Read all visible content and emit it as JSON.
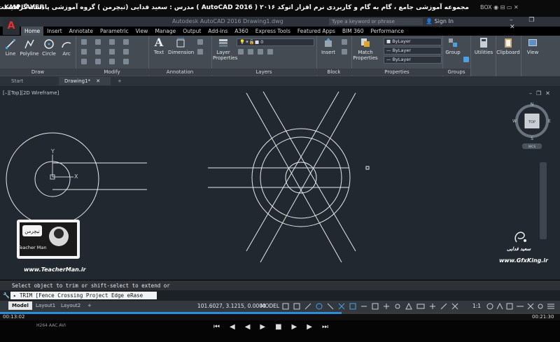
{
  "player": {
    "logo": "KMPLAYER",
    "title": "مجموعه آموزشی جامع ، گام به گام و کاربردی نرم افزار  اتوکد ۲۰۱۶ ( AutoCAD  2016 )  مدرس : سعید فدایی (تیچرمن ) گروه آموزشی پادشاه گرافیست ها",
    "top_icons": "BOX ◉ ⊟ ▭ ✕",
    "time_elapsed": "00:13:02",
    "time_total": "00:21:30",
    "progress": 0.61,
    "codec_labels": "H264  AAC  AVI",
    "controls": [
      "⏮",
      "◀◀",
      "▶",
      "■",
      "▶▶",
      "⏭"
    ]
  },
  "app": {
    "logo": "A",
    "file_name": "Autodesk AutoCAD 2016    Drawing1.dwg",
    "search_placeholder": "Type a keyword or phrase",
    "sign_in": "Sign In",
    "window_buttons": "– ❐ ✕"
  },
  "ribbon": {
    "tabs": [
      "Home",
      "Insert",
      "Annotate",
      "Parametric",
      "View",
      "Manage",
      "Output",
      "Add-ins",
      "A360",
      "Express Tools",
      "Featured Apps",
      "BIM 360",
      "Performance"
    ],
    "active_tab": "Home",
    "draw": {
      "label": "Draw",
      "line": "Line",
      "polyline": "Polyline",
      "circle": "Circle",
      "arc": "Arc"
    },
    "modify": {
      "label": "Modify"
    },
    "annotation": {
      "label": "Annotation",
      "text": "Text",
      "dimension": "Dimension"
    },
    "layers": {
      "label": "Layers",
      "layer_properties": "Layer Properties",
      "current_layer": "0"
    },
    "block": {
      "label": "Block",
      "insert": "Insert"
    },
    "properties": {
      "label": "Properties",
      "match": "Match Properties",
      "color": "ByLayer",
      "linetype": "ByLayer",
      "lineweight": "ByLayer"
    },
    "groups": {
      "label": "Groups",
      "group": "Group"
    },
    "utilities": "Utilities",
    "clipboard": "Clipboard",
    "view": "View"
  },
  "file_tabs": {
    "start": "Start",
    "drawing": "Drawing1*",
    "add": "+"
  },
  "viewport": {
    "label": "[–][Top][2D Wireframe]",
    "viewcube_top": "TOP",
    "compass_n": "N",
    "compass_s": "S",
    "compass_e": "E",
    "compass_w": "W",
    "wcs": "WCS"
  },
  "watermarks": {
    "teacherman_url": "www.TeacherMan.ir",
    "teacherman_logo": "Teacher Man",
    "teacherman_fa": "تیچرمن",
    "gfx_url": "www.GfxKing.ir",
    "gfx_name": "سعید فدایی"
  },
  "command": {
    "history": "Select object to trim or shift-select to extend or",
    "prompt": "TRIM [Fence Crossing Project Edge eRase Undo]:"
  },
  "status": {
    "layout_tabs": [
      "Model",
      "Layout1",
      "Layout2"
    ],
    "add": "+",
    "coords": "101.6027, 3.1215, 0.0000",
    "model": "MODEL",
    "scale": "1:1"
  },
  "colors": {
    "accent": "#2a8fd8",
    "canvas": "#212830",
    "ribbon": "#454b53",
    "logo_red": "#e5322d"
  }
}
